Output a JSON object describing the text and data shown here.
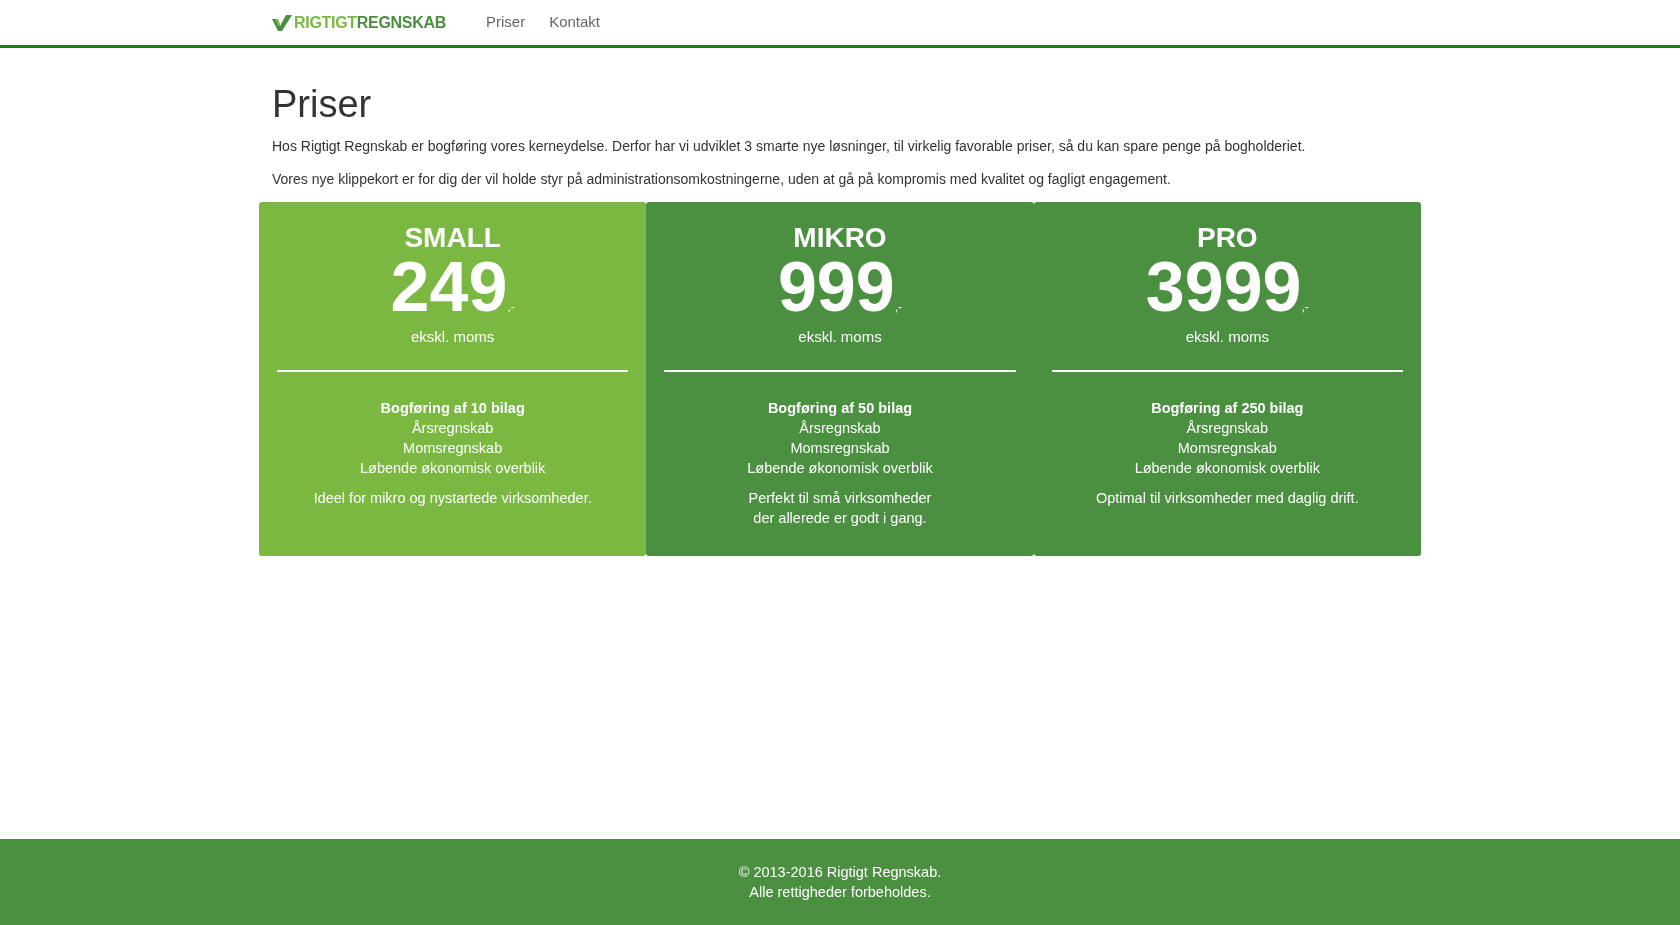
{
  "navbar": {
    "logo_parts": [
      "RIGTIGT",
      "REGNSKAB"
    ],
    "links": [
      {
        "label": "Priser",
        "selected": false
      },
      {
        "label": "Kontakt",
        "selected": false
      }
    ]
  },
  "page": {
    "title": "Priser",
    "paragraphs": [
      "Hos Rigtigt Regnskab er bogføring vores kerneydelse. Derfor har vi udviklet 3 smarte nye løsninger, til virkelig favorable priser, så du kan spare penge på bogholderiet.",
      "Vores nye klippekort er for dig der vil holde styr på administrationsomkostningerne, uden at gå på kompromis med kvalitet og fagligt engagement."
    ]
  },
  "plans": [
    {
      "name": "SMALL",
      "price": "249",
      "suffix": ",-",
      "vat_note": "ekskl. moms",
      "highlighted": true,
      "features": [
        "Bogføring af 10 bilag",
        "Årsregnskab",
        "Momsregnskab",
        "Løbende økonomisk overblik"
      ],
      "description": [
        "Ideel for mikro og nystartede virksomheder."
      ]
    },
    {
      "name": "MIKRO",
      "price": "999",
      "suffix": ",-",
      "vat_note": "ekskl. moms",
      "highlighted": false,
      "features": [
        "Bogføring af 50 bilag",
        "Årsregnskab",
        "Momsregnskab",
        "Løbende økonomisk overblik"
      ],
      "description": [
        "Perfekt til små virksomheder",
        "der allerede er godt i gang."
      ]
    },
    {
      "name": "PRO",
      "price": "3999",
      "suffix": ",-",
      "vat_note": "ekskl. moms",
      "highlighted": false,
      "features": [
        "Bogføring af 250 bilag",
        "Årsregnskab",
        "Momsregnskab",
        "Løbende økonomisk overblik"
      ],
      "description": [
        "Optimal til virksomheder med daglig drift."
      ]
    }
  ],
  "footer": {
    "lines": [
      "© 2013-2016 Rigtigt Regnskab.",
      "Alle rettigheder forbeholdes."
    ]
  }
}
